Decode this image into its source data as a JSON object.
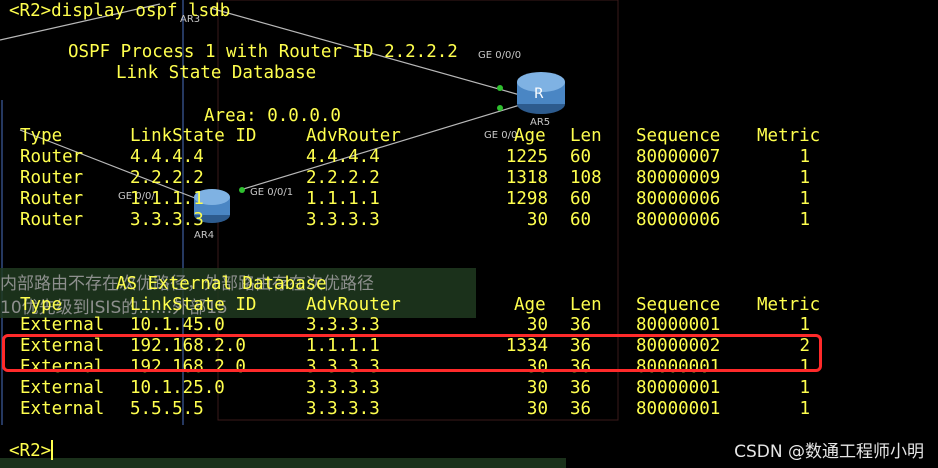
{
  "terminal": {
    "prompt_command": "<R2>display ospf lsdb",
    "process_line": "OSPF Process 1 with Router ID 2.2.2.2",
    "db_title": "Link State Database",
    "area_line": "Area: 0.0.0.0",
    "router_table": {
      "headers": [
        "Type",
        "LinkState ID",
        "AdvRouter",
        "Age",
        "Len",
        "Sequence",
        "Metric"
      ],
      "rows": [
        [
          "Router",
          "4.4.4.4",
          "4.4.4.4",
          "1225",
          "60",
          "80000007",
          "1"
        ],
        [
          "Router",
          "2.2.2.2",
          "2.2.2.2",
          "1318",
          "108",
          "80000009",
          "1"
        ],
        [
          "Router",
          "1.1.1.1",
          "1.1.1.1",
          "1298",
          "60",
          "80000006",
          "1"
        ],
        [
          "Router",
          "3.3.3.3",
          "3.3.3.3",
          "30",
          "60",
          "80000006",
          "1"
        ]
      ]
    },
    "external_title": "AS External Database",
    "external_table": {
      "headers": [
        "Type",
        "LinkState ID",
        "AdvRouter",
        "Age",
        "Len",
        "Sequence",
        "Metric"
      ],
      "rows": [
        [
          "External",
          "10.1.45.0",
          "3.3.3.3",
          "30",
          "36",
          "80000001",
          "1"
        ],
        [
          "External",
          "192.168.2.0",
          "1.1.1.1",
          "1334",
          "36",
          "80000002",
          "2"
        ],
        [
          "External",
          "192.168.2.0",
          "3.3.3.3",
          "30",
          "36",
          "80000001",
          "1"
        ],
        [
          "External",
          "10.1.25.0",
          "3.3.3.3",
          "30",
          "36",
          "80000001",
          "1"
        ],
        [
          "External",
          "5.5.5.5",
          "3.3.3.3",
          "30",
          "36",
          "80000001",
          "1"
        ]
      ]
    },
    "final_prompt": "<R2>"
  },
  "topology": {
    "ar3_label": "AR3",
    "ar5_label": "AR5",
    "ar4_label": "AR4",
    "ar5_port": "GE 0/0/0",
    "ar5_port2": "GE 0/0",
    "ar4_port": "GE 0/0/1",
    "ar4_port2": "GE 0/0/",
    "router_glyph": "R"
  },
  "overlay": {
    "cn_line1": "内部路由不存在次优路径，外部路由存在次优路径",
    "cn_line2": "10优先级到ISIS的……外部15"
  },
  "watermark": "CSDN @数通工程师小明",
  "colors": {
    "terminal_text": "#ffff4e",
    "background": "#000000",
    "highlight": "#ff2a2a"
  }
}
